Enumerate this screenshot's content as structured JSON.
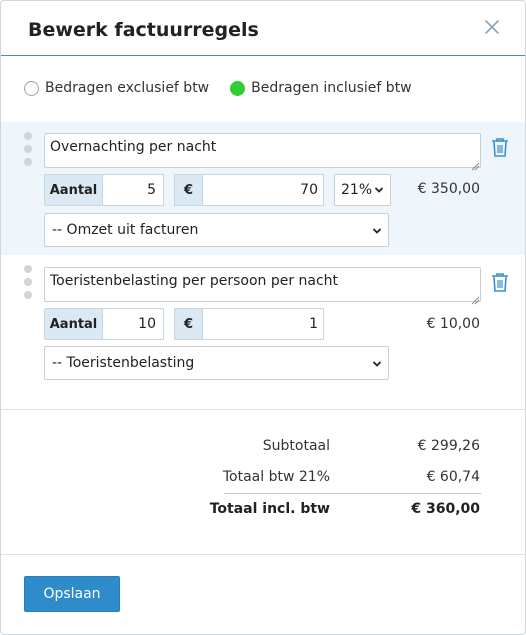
{
  "dialog": {
    "title": "Bewerk factuurregels",
    "close_icon": "close-icon"
  },
  "price_mode": {
    "options": [
      {
        "label": "Bedragen exclusief btw",
        "selected": false
      },
      {
        "label": "Bedragen inclusief btw",
        "selected": true
      }
    ],
    "selected_color": "#35cc3a"
  },
  "lines": [
    {
      "description": "Overnachting per nacht",
      "quantity_label": "Aantal",
      "quantity": "5",
      "currency_label": "€",
      "price": "70",
      "vat": "21%",
      "amount": "€ 350,00",
      "category": "-- Omzet uit facturen",
      "highlighted": true
    },
    {
      "description": "Toeristenbelasting per persoon per nacht",
      "quantity_label": "Aantal",
      "quantity": "10",
      "currency_label": "€",
      "price": "1",
      "amount": "€ 10,00",
      "category": "-- Toeristenbelasting",
      "highlighted": false
    }
  ],
  "totals": {
    "subtotal_label": "Subtotaal",
    "subtotal_value": "€ 299,26",
    "vat_label": "Totaal btw 21%",
    "vat_value": "€ 60,74",
    "total_label": "Totaal incl. btw",
    "total_value": "€ 360,00"
  },
  "footer": {
    "save_label": "Opslaan"
  },
  "colors": {
    "accent": "#2f8ccb",
    "highlight_bg": "#eff6fb",
    "trash_icon": "#3a8fcf"
  }
}
